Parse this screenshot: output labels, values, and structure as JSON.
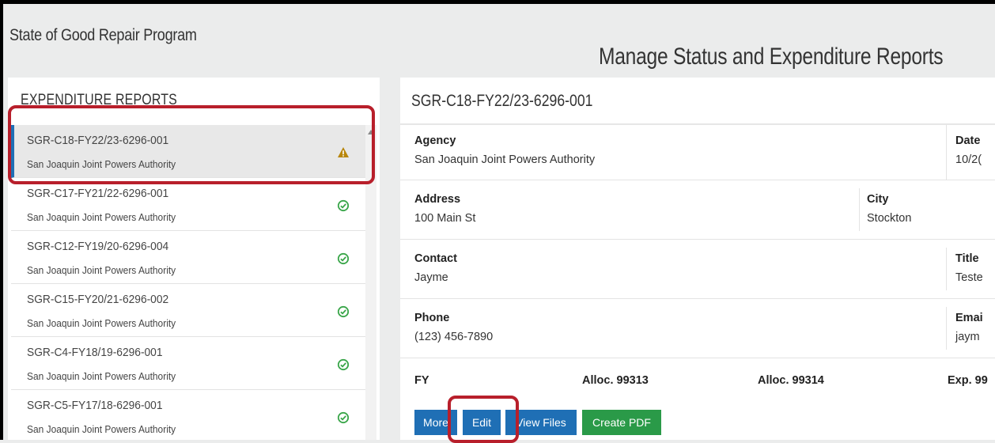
{
  "app": {
    "title": "State of Good Repair Program"
  },
  "page": {
    "title": "Manage Status and Expenditure Reports"
  },
  "sidebar": {
    "header": "EXPENDITURE REPORTS",
    "items": [
      {
        "id": "SGR-C18-FY22/23-6296-001",
        "agency": "San Joaquin Joint Powers Authority",
        "status": "warning"
      },
      {
        "id": "SGR-C17-FY21/22-6296-001",
        "agency": "San Joaquin Joint Powers Authority",
        "status": "complete"
      },
      {
        "id": "SGR-C12-FY19/20-6296-004",
        "agency": "San Joaquin Joint Powers Authority",
        "status": "complete"
      },
      {
        "id": "SGR-C15-FY20/21-6296-002",
        "agency": "San Joaquin Joint Powers Authority",
        "status": "complete"
      },
      {
        "id": "SGR-C4-FY18/19-6296-001",
        "agency": "San Joaquin Joint Powers Authority",
        "status": "complete"
      },
      {
        "id": "SGR-C5-FY17/18-6296-001",
        "agency": "San Joaquin Joint Powers Authority",
        "status": "complete"
      }
    ]
  },
  "detail": {
    "title": "SGR-C18-FY22/23-6296-001",
    "agency_label": "Agency",
    "agency_value": "San Joaquin Joint Powers Authority",
    "date_label": "Date",
    "date_value": "10/2(",
    "address_label": "Address",
    "address_value": "100 Main St",
    "city_label": "City",
    "city_value": "Stockton",
    "contact_label": "Contact",
    "contact_value": "Jayme",
    "title_label": "Title",
    "title_value": "Teste",
    "phone_label": "Phone",
    "phone_value": "(123) 456-7890",
    "email_label": "Emai",
    "email_value": "jaym",
    "fy_label": "FY",
    "alloc1_label": "Alloc. 99313",
    "alloc2_label": "Alloc. 99314",
    "exp_label": "Exp. 99"
  },
  "buttons": {
    "more": "More",
    "edit": "Edit",
    "view_files": "View Files",
    "create_pdf": "Create PDF"
  },
  "colors": {
    "accent_blue": "#1f6fb5",
    "green": "#2a9a48",
    "warning": "#b8860b",
    "success": "#3aa64a",
    "highlight_red": "#b81f2b"
  }
}
